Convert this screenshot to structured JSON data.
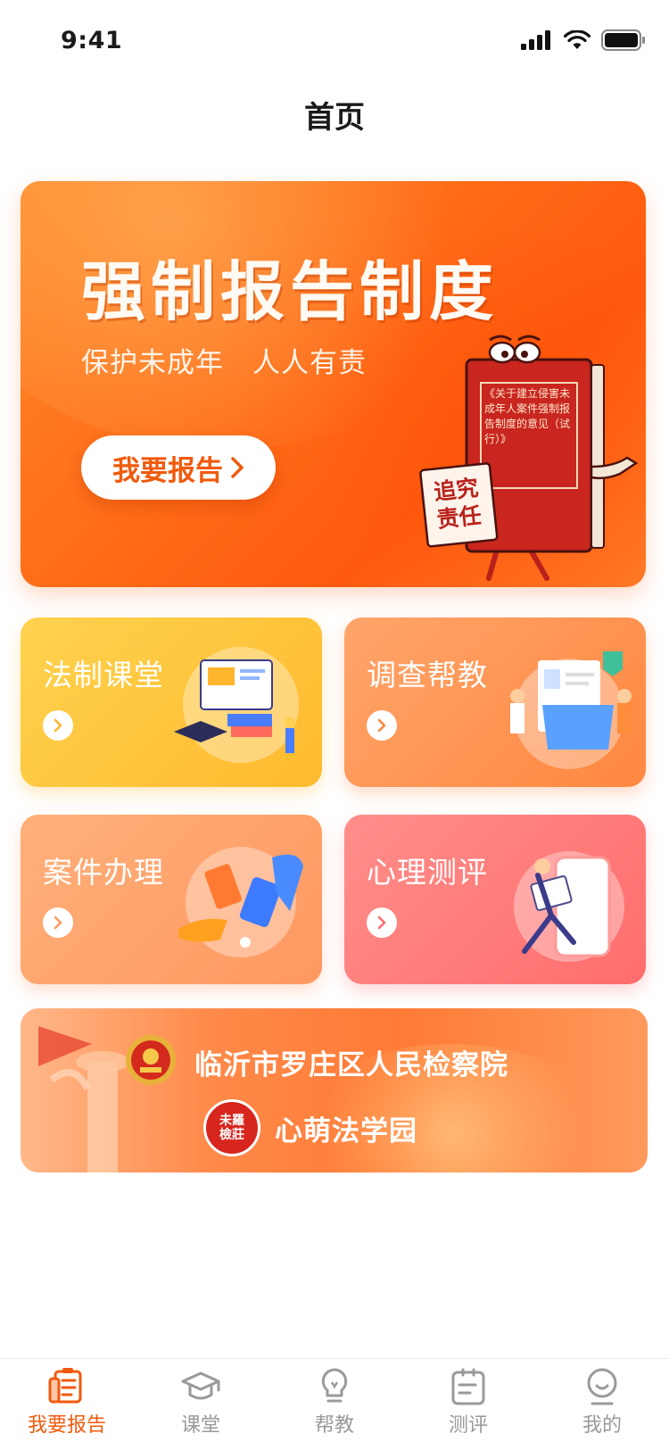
{
  "status_bar": {
    "time": "9:41"
  },
  "nav": {
    "title": "首页"
  },
  "hero": {
    "title": "强制报告制度",
    "subtitle": "保护未成年　人人有责",
    "button_label": "我要报告",
    "book_text": "《关于建立侵害未成年人案件强制报告制度的意见（试行）》",
    "sign_text": "追究责任"
  },
  "cards": [
    {
      "title": "法制课堂"
    },
    {
      "title": "调查帮教"
    },
    {
      "title": "案件办理"
    },
    {
      "title": "心理测评"
    }
  ],
  "org_banner": {
    "name": "临沂市罗庄区人民检察院",
    "sub_brand": "心萌法学园",
    "seal_text": "未羅檢莊"
  },
  "tabbar": {
    "items": [
      {
        "label": "我要报告",
        "icon": "report-icon",
        "active": true
      },
      {
        "label": "课堂",
        "icon": "graduation-cap-icon",
        "active": false
      },
      {
        "label": "帮教",
        "icon": "lightbulb-icon",
        "active": false
      },
      {
        "label": "测评",
        "icon": "clipboard-icon",
        "active": false
      },
      {
        "label": "我的",
        "icon": "user-icon",
        "active": false
      }
    ]
  },
  "colors": {
    "accent": "#f05a0d",
    "inactive": "#9a9a9a",
    "card_yellow": "#ffc23a",
    "card_orange": "#ff9550",
    "card_peach": "#ffa46e",
    "card_red": "#ff7878"
  }
}
